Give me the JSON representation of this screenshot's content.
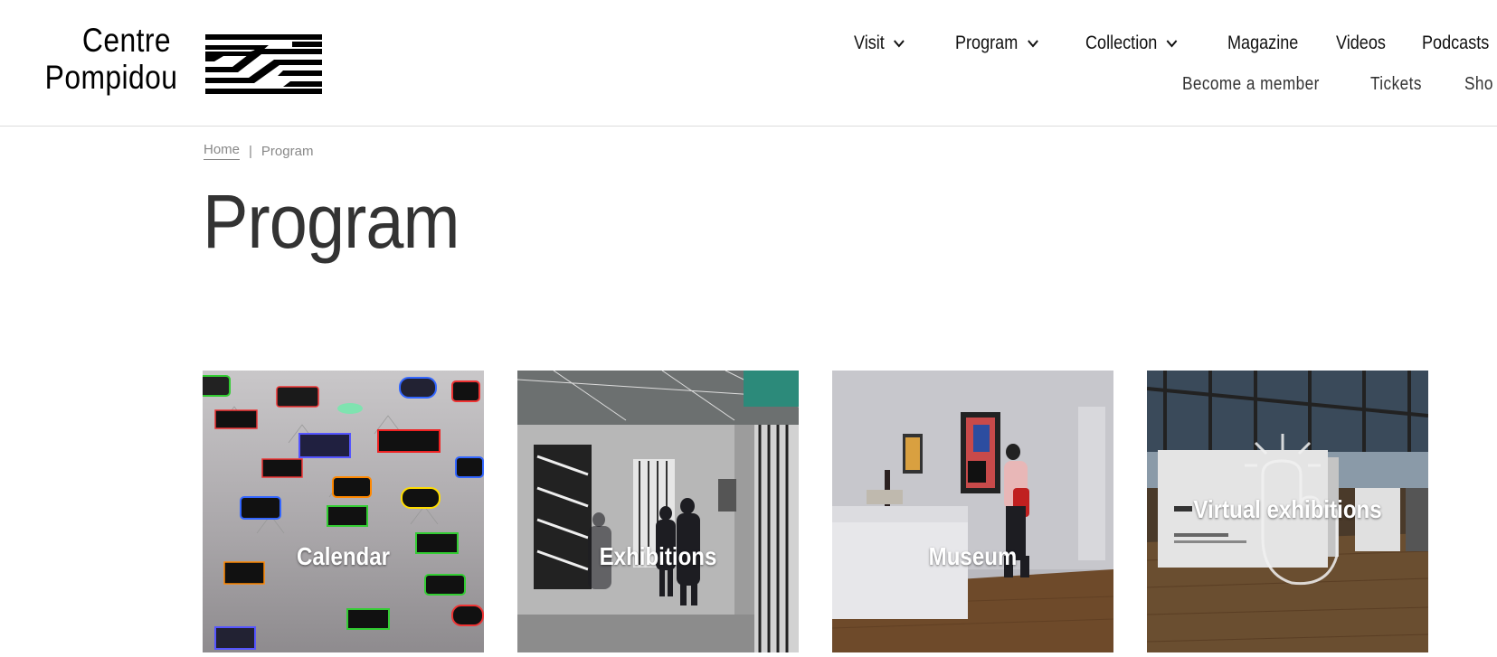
{
  "brand": {
    "line1": "Centre",
    "line2": "Pompidou"
  },
  "nav": {
    "main": [
      {
        "label": "Visit",
        "has_dropdown": true
      },
      {
        "label": "Program",
        "has_dropdown": true
      },
      {
        "label": "Collection",
        "has_dropdown": true
      },
      {
        "label": "Magazine",
        "has_dropdown": false
      },
      {
        "label": "Videos",
        "has_dropdown": false
      },
      {
        "label": "Podcasts",
        "has_dropdown": false
      }
    ],
    "secondary": [
      {
        "label": "Become a member"
      },
      {
        "label": "Tickets"
      },
      {
        "label": "Sho"
      }
    ]
  },
  "breadcrumb": {
    "home": "Home",
    "separator": "|",
    "current": "Program"
  },
  "page": {
    "title": "Program"
  },
  "cards": [
    {
      "label": "Calendar"
    },
    {
      "label": "Exhibitions"
    },
    {
      "label": "Museum"
    },
    {
      "label": "Virtual exhibitions"
    }
  ],
  "colors": {
    "text": "#222222",
    "muted": "#888888",
    "divider": "#dcdcdc"
  }
}
